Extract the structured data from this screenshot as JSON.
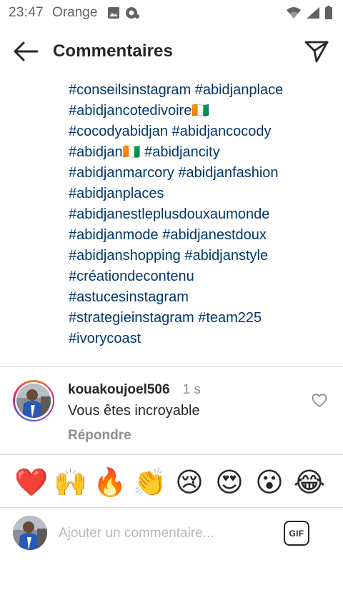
{
  "status_bar": {
    "time": "23:47",
    "carrier": "Orange",
    "left_icons": [
      "image-icon",
      "chat-sync-icon"
    ],
    "right_icons": [
      "wifi-icon",
      "signal-icon",
      "battery-icon"
    ]
  },
  "header": {
    "title": "Commentaires",
    "back_icon": "arrow-left-icon",
    "send_icon": "paper-plane-icon"
  },
  "caption": {
    "hashtag_lines": [
      "#conseilsinstagram #abidjanplace",
      "#abidjancotedivoire🇨🇮",
      "#cocodyabidjan #abidjancocody",
      "#abidjan🇨🇮 #abidjancity",
      "#abidjanmarcory #abidjanfashion",
      "#abidjanplaces",
      "#abidjanestleplusdouxaumonde",
      "#abidjanmode #abidjanestdoux",
      "#abidjanshopping #abidjanstyle",
      "#créationdecontenu",
      "#astucesinstagram",
      "#strategieinstagram #team225",
      "#ivorycoast"
    ]
  },
  "comment": {
    "username": "kouakoujoel506",
    "time": "1 s",
    "text": "Vous êtes incroyable",
    "reply_label": "Répondre",
    "like_icon": "heart-outline-icon"
  },
  "emoji_bar": {
    "emojis": [
      "❤️",
      "🙌",
      "🔥",
      "👏",
      "😢",
      "😍",
      "😮",
      "😂"
    ]
  },
  "composer": {
    "placeholder": "Ajouter un commentaire...",
    "gif_label": "GIF"
  },
  "colors": {
    "hashtag": "#00376b",
    "text": "#262626",
    "muted": "#8e8e8e",
    "divider": "#dbdbdb"
  }
}
